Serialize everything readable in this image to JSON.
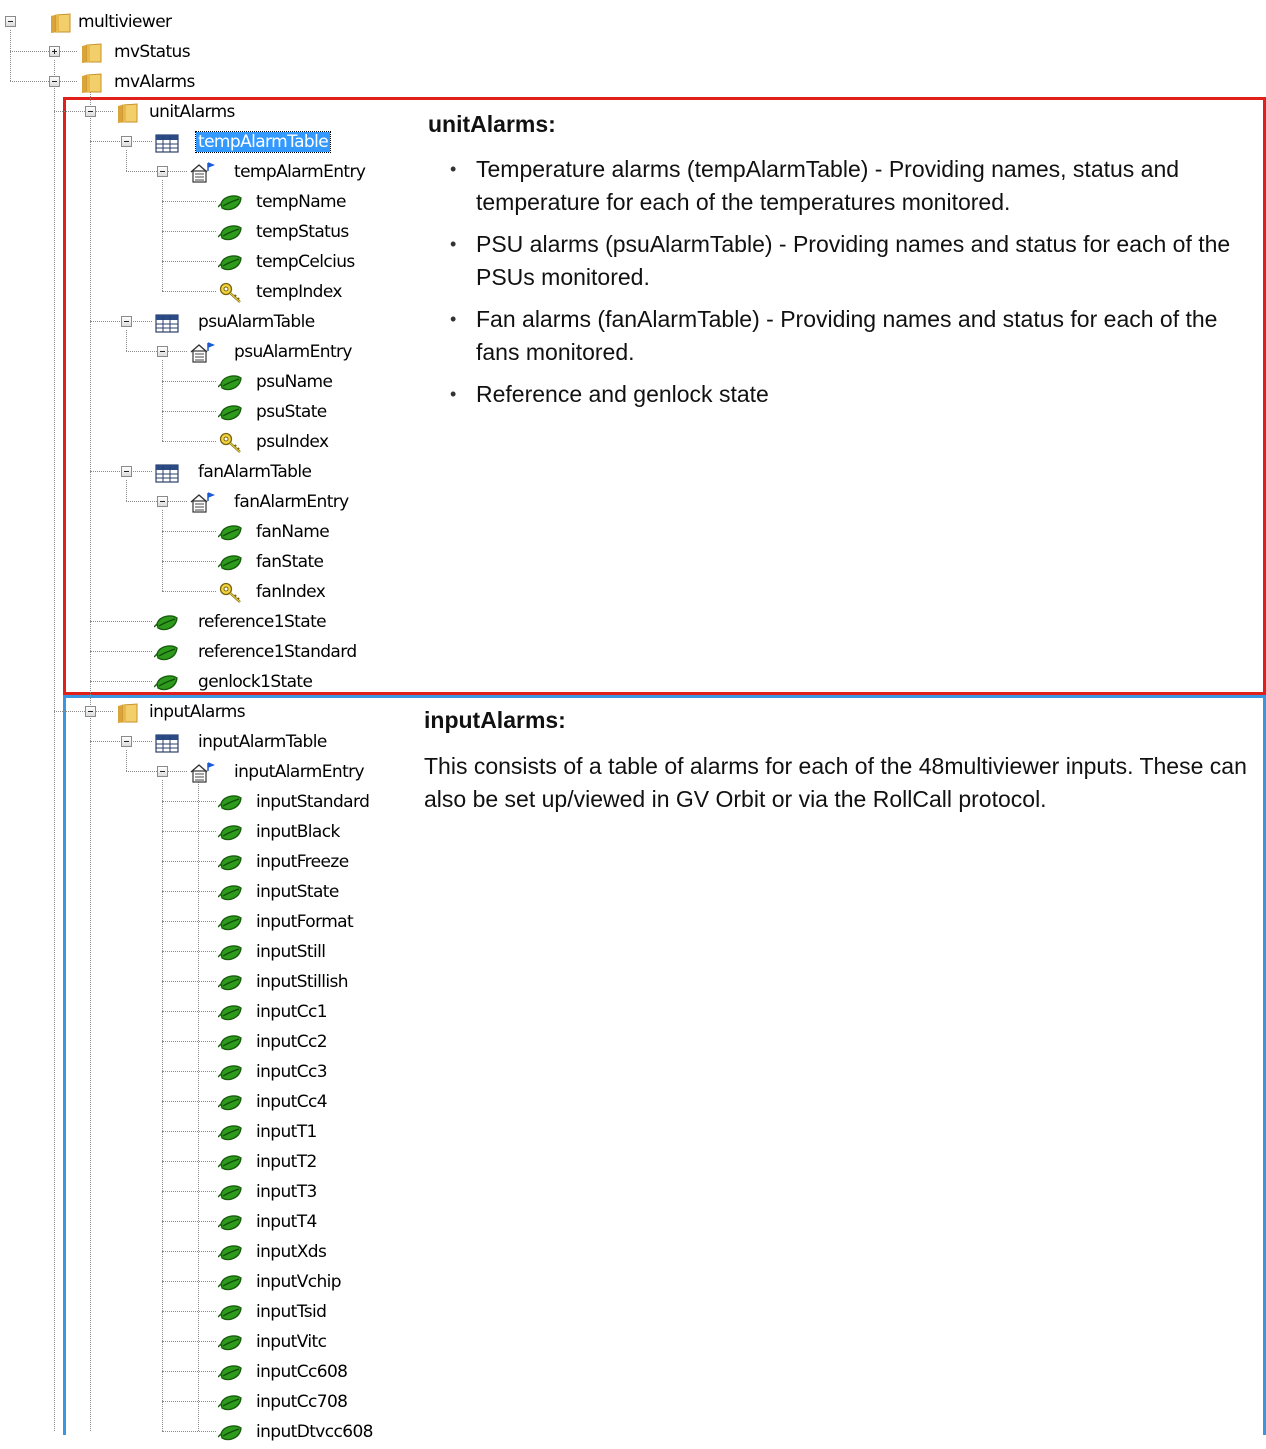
{
  "tree": {
    "nodes": [
      {
        "label": "multiviewer",
        "icon": "folder-icon",
        "expander": "minus",
        "depth": 0
      },
      {
        "label": "mvStatus",
        "icon": "folder-icon",
        "expander": "plus",
        "depth": 1
      },
      {
        "label": "mvAlarms",
        "icon": "folder-icon",
        "expander": "minus",
        "depth": 1
      },
      {
        "label": "unitAlarms",
        "icon": "folder-icon",
        "expander": "minus",
        "depth": 2
      },
      {
        "label": "tempAlarmTable",
        "icon": "table-icon",
        "expander": "minus",
        "depth": 3,
        "selected": true
      },
      {
        "label": "tempAlarmEntry",
        "icon": "entry-icon",
        "expander": "minus",
        "depth": 4
      },
      {
        "label": "tempName",
        "icon": "leaf-icon",
        "depth": 5
      },
      {
        "label": "tempStatus",
        "icon": "leaf-icon",
        "depth": 5
      },
      {
        "label": "tempCelcius",
        "icon": "leaf-icon",
        "depth": 5
      },
      {
        "label": "tempIndex",
        "icon": "key-icon",
        "depth": 5
      },
      {
        "label": "psuAlarmTable",
        "icon": "table-icon",
        "expander": "minus",
        "depth": 3
      },
      {
        "label": "psuAlarmEntry",
        "icon": "entry-icon",
        "expander": "minus",
        "depth": 4
      },
      {
        "label": "psuName",
        "icon": "leaf-icon",
        "depth": 5
      },
      {
        "label": "psuState",
        "icon": "leaf-icon",
        "depth": 5
      },
      {
        "label": "psuIndex",
        "icon": "key-icon",
        "depth": 5
      },
      {
        "label": "fanAlarmTable",
        "icon": "table-icon",
        "expander": "minus",
        "depth": 3
      },
      {
        "label": "fanAlarmEntry",
        "icon": "entry-icon",
        "expander": "minus",
        "depth": 4
      },
      {
        "label": "fanName",
        "icon": "leaf-icon",
        "depth": 5
      },
      {
        "label": "fanState",
        "icon": "leaf-icon",
        "depth": 5
      },
      {
        "label": "fanIndex",
        "icon": "key-icon",
        "depth": 5
      },
      {
        "label": "reference1State",
        "icon": "leaf-icon",
        "depth": 3
      },
      {
        "label": "reference1Standard",
        "icon": "leaf-icon",
        "depth": 3
      },
      {
        "label": "genlock1State",
        "icon": "leaf-icon",
        "depth": 3
      },
      {
        "label": "inputAlarms",
        "icon": "folder-icon",
        "expander": "minus",
        "depth": 2
      },
      {
        "label": "inputAlarmTable",
        "icon": "table-icon",
        "expander": "minus",
        "depth": 3
      },
      {
        "label": "inputAlarmEntry",
        "icon": "entry-icon",
        "expander": "minus",
        "depth": 4
      },
      {
        "label": "inputStandard",
        "icon": "leaf-icon",
        "depth": 5
      },
      {
        "label": "inputBlack",
        "icon": "leaf-icon",
        "depth": 5
      },
      {
        "label": "inputFreeze",
        "icon": "leaf-icon",
        "depth": 5
      },
      {
        "label": "inputState",
        "icon": "leaf-icon",
        "depth": 5
      },
      {
        "label": "inputFormat",
        "icon": "leaf-icon",
        "depth": 5
      },
      {
        "label": "inputStill",
        "icon": "leaf-icon",
        "depth": 5
      },
      {
        "label": "inputStillish",
        "icon": "leaf-icon",
        "depth": 5
      },
      {
        "label": "inputCc1",
        "icon": "leaf-icon",
        "depth": 5
      },
      {
        "label": "inputCc2",
        "icon": "leaf-icon",
        "depth": 5
      },
      {
        "label": "inputCc3",
        "icon": "leaf-icon",
        "depth": 5
      },
      {
        "label": "inputCc4",
        "icon": "leaf-icon",
        "depth": 5
      },
      {
        "label": "inputT1",
        "icon": "leaf-icon",
        "depth": 5
      },
      {
        "label": "inputT2",
        "icon": "leaf-icon",
        "depth": 5
      },
      {
        "label": "inputT3",
        "icon": "leaf-icon",
        "depth": 5
      },
      {
        "label": "inputT4",
        "icon": "leaf-icon",
        "depth": 5
      },
      {
        "label": "inputXds",
        "icon": "leaf-icon",
        "depth": 5
      },
      {
        "label": "inputVchip",
        "icon": "leaf-icon",
        "depth": 5
      },
      {
        "label": "inputTsid",
        "icon": "leaf-icon",
        "depth": 5
      },
      {
        "label": "inputVitc",
        "icon": "leaf-icon",
        "depth": 5
      },
      {
        "label": "inputCc608",
        "icon": "leaf-icon",
        "depth": 5
      },
      {
        "label": "inputCc708",
        "icon": "leaf-icon",
        "depth": 5
      },
      {
        "label": "inputDtvcc608",
        "icon": "leaf-icon",
        "depth": 5
      }
    ]
  },
  "unit_panel": {
    "heading": "unitAlarms:",
    "bullets": [
      "Temperature alarms (tempAlarmTable) - Providing names, status and temperature for each of the temperatures monitored.",
      "PSU alarms (psuAlarmTable) - Providing names and status for each of the PSUs monitored.",
      "Fan alarms (fanAlarmTable) - Providing names and status for each of the fans monitored.",
      "Reference and genlock state"
    ]
  },
  "input_panel": {
    "heading": "inputAlarms:",
    "text": "This consists of a table of alarms for each of the 48multiviewer inputs. These can also be set up/viewed in GV Orbit or via the RollCall protocol."
  },
  "colors": {
    "unit_border": "#e0201a",
    "input_border": "#3a96e0",
    "selection": "#3399ff"
  }
}
